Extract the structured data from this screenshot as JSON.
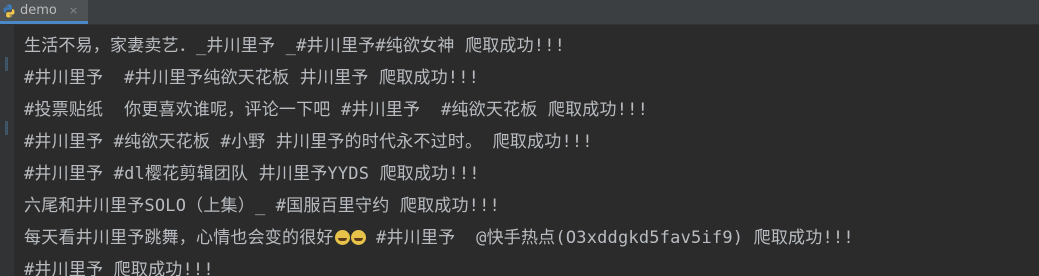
{
  "tab": {
    "label": "demo",
    "close": "×",
    "icon": "python-icon"
  },
  "console": {
    "lines": [
      "生活不易，家妻卖艺．_井川里予 _#井川里予#纯欲女神 爬取成功!!!",
      "#井川里予  #井川里予纯欲天花板 井川里予 爬取成功!!!",
      "#投票贴纸  你更喜欢谁呢，评论一下吧 #井川里予  #纯欲天花板 爬取成功!!!",
      "#井川里予 #纯欲天花板 #小野 井川里予的时代永不过时。 爬取成功!!!",
      "#井川里予 #dl樱花剪辑团队 井川里予YYDS 爬取成功!!!",
      "六尾和井川里予SOLO（上集）_ #国服百里守约 爬取成功!!!",
      "每天看井川里予跳舞，心情也会变的很好",
      "#井川里予 爬取成功!!!"
    ],
    "line7_suffix": " #井川里予  @快手热点(O3xddgkd5fav5if9) 爬取成功!!!",
    "emoji_icons": [
      "grinning-face-icon",
      "grinning-face-icon"
    ]
  },
  "colors": {
    "background": "#2b2b2b",
    "text": "#b8bcc0",
    "tab_underline": "#4a88c7"
  }
}
